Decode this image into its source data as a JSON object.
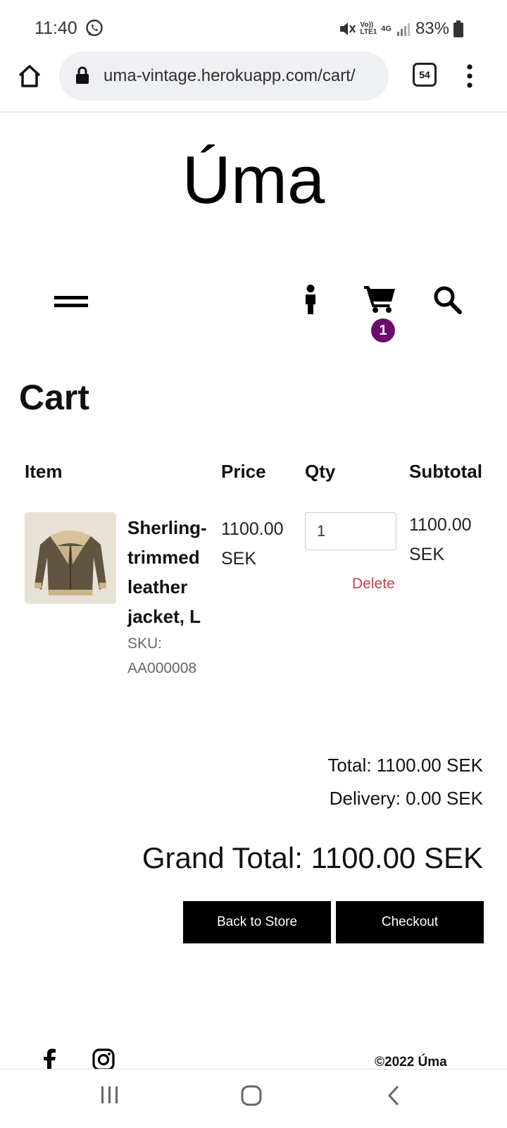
{
  "status_bar": {
    "time": "11:40",
    "battery": "83%",
    "icons": [
      "whatsapp-icon",
      "mute-icon",
      "volte-icon",
      "4g-icon",
      "signal-icon",
      "battery-icon"
    ],
    "network_label": "4G",
    "volte_label_top": "Vo))",
    "volte_label_bottom": "LTE1"
  },
  "browser": {
    "url": "uma-vintage.herokuapp.com/cart/",
    "tab_count": "54",
    "icons": [
      "home-icon",
      "lock-icon",
      "tabs-icon",
      "more-icon"
    ]
  },
  "site": {
    "logo": "Úma",
    "icons": [
      "hamburger-icon",
      "user-icon",
      "cart-icon",
      "search-icon"
    ],
    "cart_count": "1",
    "badge_color": "#6b0c6b"
  },
  "cart": {
    "title": "Cart",
    "columns": [
      "Item",
      "Price",
      "Qty",
      "Subtotal"
    ],
    "items": [
      {
        "name": "Sherling-trimmed leather jacket, L",
        "sku_label": "SKU:",
        "sku": "AA000008",
        "price": "1100.00 SEK",
        "qty": "1",
        "delete_label": "Delete",
        "subtotal": "1100.00 SEK"
      }
    ],
    "total": "Total: 1100.00 SEK",
    "delivery": "Delivery: 0.00 SEK",
    "grand_total": "Grand Total: 1100.00 SEK",
    "back_button": "Back to Store",
    "checkout_button": "Checkout",
    "delete_color": "#c0434f"
  },
  "footer": {
    "icons": [
      "facebook-icon",
      "instagram-icon"
    ],
    "copyright": "©2022 Úma"
  },
  "nav_bar": {
    "icons": [
      "recents-icon",
      "home-nav-icon",
      "back-icon"
    ]
  }
}
